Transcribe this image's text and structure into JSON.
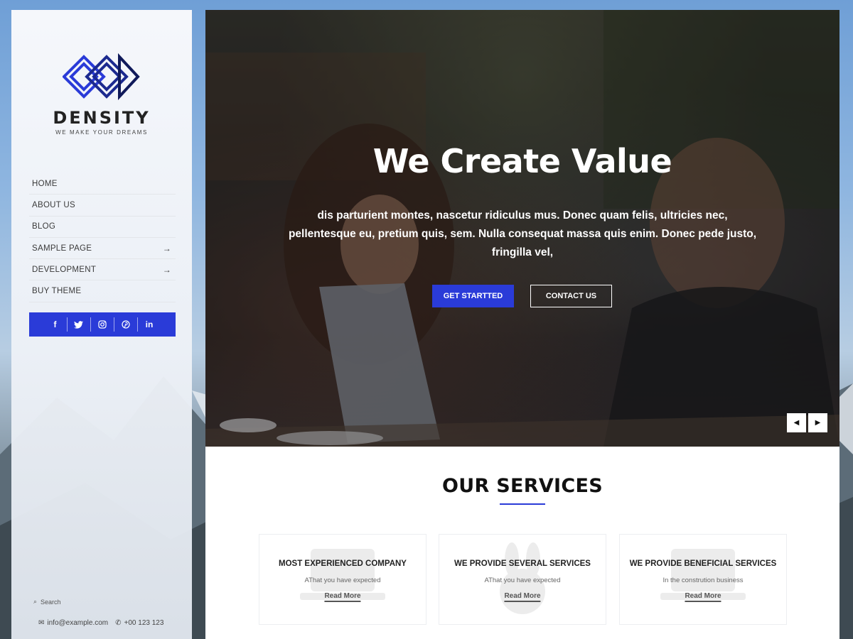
{
  "brand": {
    "name": "DENSITY",
    "tagline": "WE MAKE YOUR DREAMS"
  },
  "nav": [
    {
      "label": "HOME",
      "has_submenu": false
    },
    {
      "label": "ABOUT US",
      "has_submenu": false
    },
    {
      "label": "BLOG",
      "has_submenu": false
    },
    {
      "label": "SAMPLE PAGE",
      "has_submenu": true
    },
    {
      "label": "DEVELOPMENT",
      "has_submenu": true
    },
    {
      "label": "BUY THEME",
      "has_submenu": false
    }
  ],
  "submenu_arrow": "→",
  "social": [
    {
      "icon": "facebook-icon",
      "glyph": "f"
    },
    {
      "icon": "twitter-icon",
      "glyph": "t"
    },
    {
      "icon": "instagram-icon",
      "glyph": "◎"
    },
    {
      "icon": "pinterest-icon",
      "glyph": "P"
    },
    {
      "icon": "linkedin-icon",
      "glyph": "in"
    }
  ],
  "search": {
    "icon": "search-icon",
    "glyph": "⌕",
    "label": "Search"
  },
  "contact": {
    "email_glyph": "✉",
    "email": "info@example.com",
    "phone_glyph": "✆",
    "phone": "+00 123 123"
  },
  "hero": {
    "title": "We Create Value",
    "text": "dis parturient montes, nascetur ridiculus mus. Donec quam felis, ultricies nec, pellentesque eu, pretium quis, sem. Nulla consequat massa quis enim. Donec pede justo, fringilla vel,",
    "primary_button": "GET STARTTED",
    "secondary_button": "CONTACT US",
    "prev_glyph": "◀",
    "next_glyph": "▶"
  },
  "services": {
    "title": "OUR SERVICES",
    "cards": [
      {
        "title": "MOST EXPERIENCED COMPANY",
        "subtitle": "AThat you have expected",
        "link": "Read More"
      },
      {
        "title": "WE PROVIDE SEVERAL SERVICES",
        "subtitle": "AThat you have expected",
        "link": "Read More"
      },
      {
        "title": "WE PROVIDE BENEFICIAL SERVICES",
        "subtitle": "In the constrution business",
        "link": "Read More"
      }
    ]
  },
  "colors": {
    "accent": "#2a3bd8",
    "text_dark": "#111111",
    "sidebar_bg": "#f3f5f9"
  }
}
